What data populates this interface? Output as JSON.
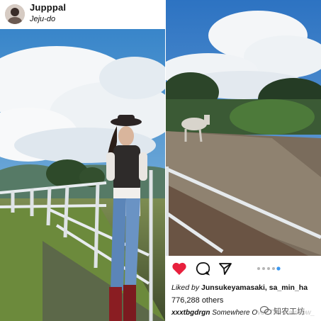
{
  "post": {
    "username": "Jupppal",
    "location": "Jeju-do"
  },
  "actions": {
    "like_icon": "heart-filled-icon",
    "comment_icon": "comment-icon",
    "share_icon": "share-icon",
    "carousel_dots": 5,
    "carousel_active_index": 4
  },
  "likes": {
    "prefix": "Liked by",
    "users": "Junsukeyamasaki, sa_min_ha",
    "count": "776,288 others"
  },
  "caption": {
    "user": "xxxtbgdrgn",
    "text": "Somewhere Over The Rainbow_"
  },
  "watermark": {
    "text": "知农工坊",
    "icon": "wechat-icon"
  },
  "colors": {
    "like": "#e8203d",
    "text": "#111111"
  }
}
